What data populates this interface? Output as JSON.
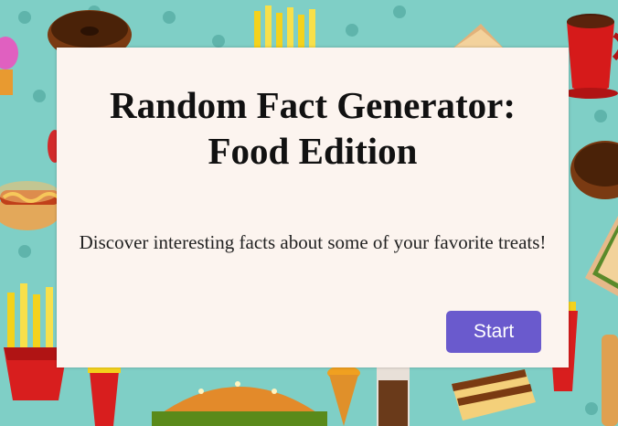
{
  "card": {
    "title_line1": "Random Fact Generator:",
    "title_line2": "Food Edition",
    "description": "Discover interesting facts about some of your favorite treats!",
    "start_label": "Start"
  },
  "colors": {
    "background": "#7fcfc6",
    "card": "#fcf4ef",
    "button": "#6a5acd",
    "button_text": "#ffffff"
  },
  "icons": [
    "donut-icon",
    "fries-icon",
    "hotdog-icon",
    "coffee-cup-icon",
    "burger-icon",
    "sandwich-icon",
    "cake-slice-icon",
    "ice-cream-icon",
    "cupcake-icon",
    "soda-icon"
  ]
}
